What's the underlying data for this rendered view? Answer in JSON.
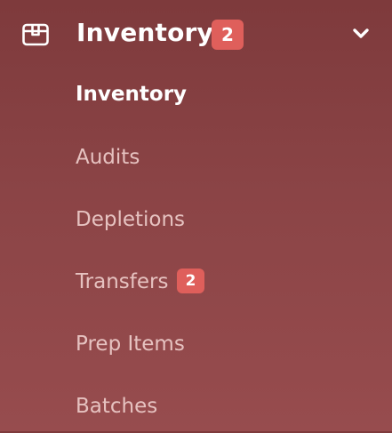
{
  "section": {
    "title": "Inventory",
    "badge": "2",
    "icon": "box-icon",
    "expand_icon": "chevron-down-icon",
    "expanded": true
  },
  "items": [
    {
      "label": "Inventory",
      "active": true
    },
    {
      "label": "Audits",
      "active": false
    },
    {
      "label": "Depletions",
      "active": false
    },
    {
      "label": "Transfers",
      "active": false,
      "badge": "2"
    },
    {
      "label": "Prep Items",
      "active": false
    },
    {
      "label": "Batches",
      "active": false
    }
  ],
  "colors": {
    "background_top": "#7e3a3c",
    "background_bottom": "#974c4e",
    "badge": "#df5f5b",
    "active_text": "#ffffff",
    "inactive_text": "#e6c2c0"
  }
}
